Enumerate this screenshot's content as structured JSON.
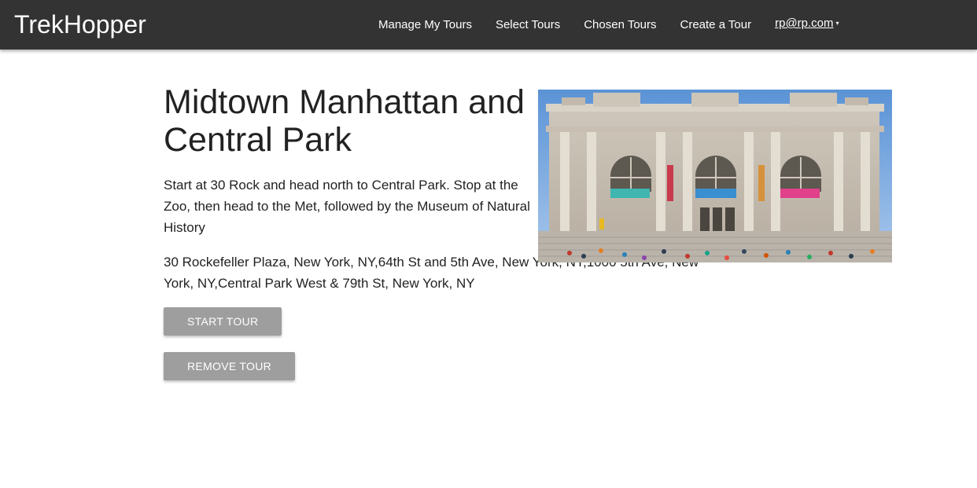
{
  "navbar": {
    "brand": "TrekHopper",
    "links": [
      {
        "label": "Manage My Tours"
      },
      {
        "label": "Select Tours"
      },
      {
        "label": "Chosen Tours"
      },
      {
        "label": "Create a Tour"
      }
    ],
    "user": {
      "email": "rp@rp.com",
      "caret": "▾"
    }
  },
  "tour": {
    "title": "Midtown Manhattan and Central Park",
    "description": "Start at 30 Rock and head north to Central Park. Stop at the Zoo, then head to the Met, followed by the Museum of Natural History",
    "addresses": "30 Rockefeller Plaza, New York, NY,64th St and 5th Ave, New York, NY,1000 5th Ave, New York, NY,Central Park West & 79th St, New York, NY",
    "image": {
      "subject": "Metropolitan Museum of Art facade"
    }
  },
  "actions": {
    "start_label": "START TOUR",
    "remove_label": "REMOVE TOUR"
  },
  "colors": {
    "navbar_bg": "#333333",
    "button_bg": "#9e9e9e",
    "text": "#222222"
  }
}
